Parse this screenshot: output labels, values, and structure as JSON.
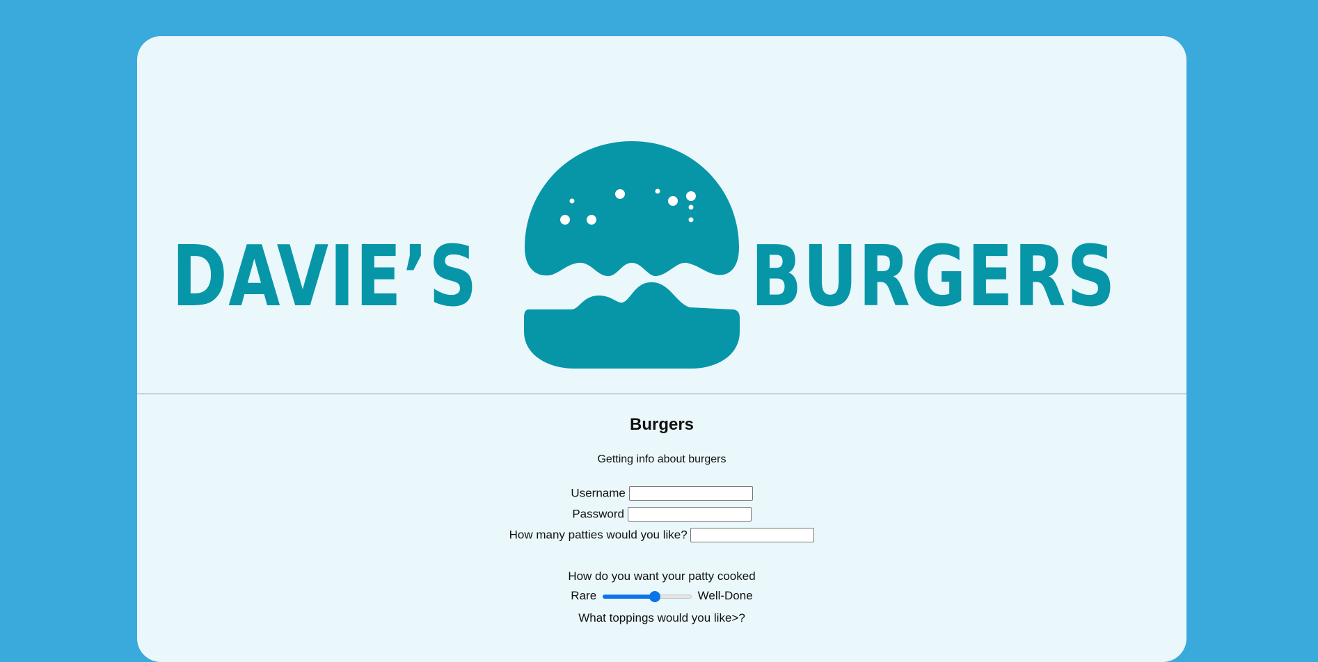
{
  "colors": {
    "page_background": "#3aa9db",
    "card_background": "#eaf7fb",
    "brand": "#0796a8",
    "slider_accent": "#0a75e8"
  },
  "logo": {
    "text_left": "DAVIE’S",
    "text_right": "BURGERS",
    "icon": "burger-icon"
  },
  "page": {
    "title": "Burgers",
    "description": "Getting info about burgers"
  },
  "form": {
    "username_label": "Username",
    "username_value": "",
    "password_label": "Password",
    "password_value": "",
    "patties_label": "How many patties would you like?",
    "patties_value": "",
    "cooked_label": "How do you want your patty cooked",
    "slider_min_label": "Rare",
    "slider_max_label": "Well-Done",
    "slider_level": 0.6,
    "toppings_label": "What toppings would you like>?"
  }
}
